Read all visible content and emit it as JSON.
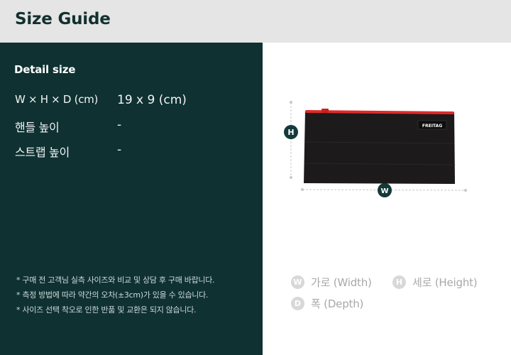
{
  "header": {
    "title": "Size Guide"
  },
  "detail": {
    "title": "Detail size",
    "rows": [
      {
        "label": "W × H × D (cm)",
        "value": "19 x 9 (cm)"
      },
      {
        "label": "핸들 높이",
        "value": "-"
      },
      {
        "label": "스트랩 높이",
        "value": "-"
      }
    ]
  },
  "notes": [
    "* 구매 전 고객님 실측 사이즈와 비교 및 상담 후 구매 바랍니다.",
    "* 측정 방법에 따라 약간의 오차(±3cm)가 있을 수 있습니다.",
    "* 사이즈 선택 착오로 인한 반품 및 교환은 되지 않습니다."
  ],
  "figure": {
    "brand_tag": "FREITAG",
    "badge_h": "H",
    "badge_w": "W",
    "colors": {
      "bag_body": "#1c1a1a",
      "zipper": "#e02a2a",
      "badge": "#14393a",
      "guide": "#c8c8c8"
    }
  },
  "legend": [
    {
      "badge": "W",
      "text": "가로 (Width)"
    },
    {
      "badge": "H",
      "text": "세로 (Height)"
    },
    {
      "badge": "D",
      "text": "폭 (Depth)"
    }
  ]
}
